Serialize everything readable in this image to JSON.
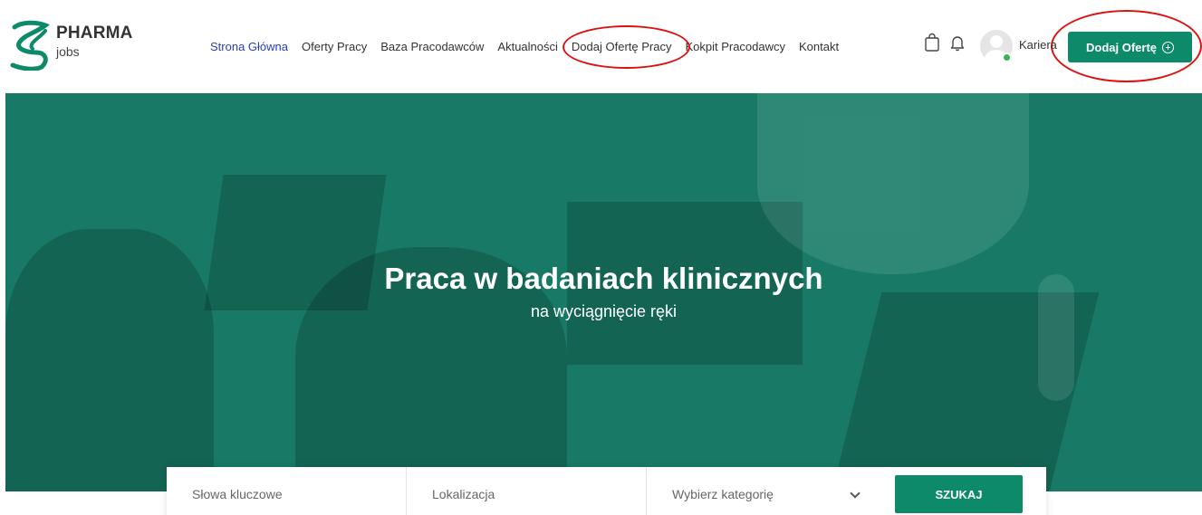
{
  "brand": {
    "name": "PHARMA",
    "sub": "jobs"
  },
  "nav": {
    "items": [
      {
        "label": "Strona Główna",
        "active": true
      },
      {
        "label": "Oferty Pracy"
      },
      {
        "label": "Baza Pracodawców"
      },
      {
        "label": "Aktualności"
      },
      {
        "label": "Dodaj Ofertę Pracy"
      },
      {
        "label": "Kokpit Pracodawcy"
      },
      {
        "label": "Kontakt"
      }
    ]
  },
  "header_right": {
    "icons": [
      "shopping-bag-icon",
      "bell-icon"
    ],
    "user_name": "Kariera",
    "cta_label": "Dodaj Ofertę"
  },
  "hero": {
    "title": "Praca w badaniach klinicznych",
    "subtitle": "na wyciągnięcie ręki"
  },
  "search": {
    "keywords_placeholder": "Słowa kluczowe",
    "location_placeholder": "Lokalizacja",
    "category_selected": "Wybierz kategorię",
    "button_label": "SZUKAJ"
  },
  "colors": {
    "brand_green": "#0d8a6a",
    "hero_green": "#187a66",
    "active_link": "#2a3dbf",
    "annotation_red": "#dd1111",
    "online_dot": "#35b558"
  }
}
